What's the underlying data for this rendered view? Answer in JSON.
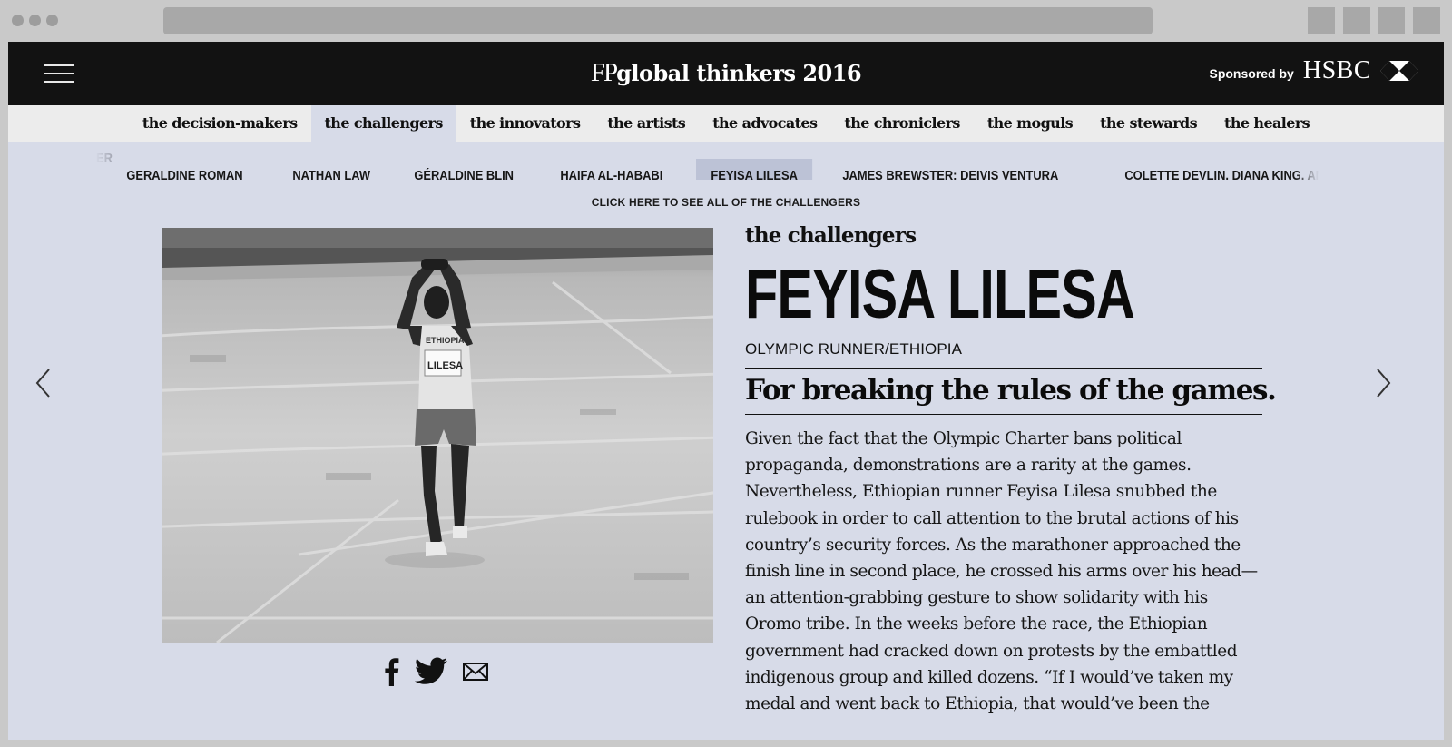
{
  "header": {
    "logo_fp": "FP",
    "logo_text": "global thinkers 2016",
    "sponsor_label": "Sponsored by",
    "sponsor_brand": "HSBC"
  },
  "categories": [
    {
      "label": "the decision-makers",
      "active": false
    },
    {
      "label": "the challengers",
      "active": true
    },
    {
      "label": "the innovators",
      "active": false
    },
    {
      "label": "the artists",
      "active": false
    },
    {
      "label": "the advocates",
      "active": false
    },
    {
      "label": "the chroniclers",
      "active": false
    },
    {
      "label": "the moguls",
      "active": false
    },
    {
      "label": "the stewards",
      "active": false
    },
    {
      "label": "the healers",
      "active": false
    }
  ],
  "names": [
    {
      "label": "ER",
      "partial": true,
      "active": false
    },
    {
      "label": "GERALDINE ROMAN",
      "partial": false,
      "active": false
    },
    {
      "label": "NATHAN LAW",
      "partial": false,
      "active": false
    },
    {
      "label": "GÉRALDINE BLIN",
      "partial": false,
      "active": false
    },
    {
      "label": "HAIFA AL-HABABI",
      "partial": false,
      "active": false
    },
    {
      "label": "FEYISA LILESA",
      "partial": false,
      "active": true
    },
    {
      "label": "JAMES BREWSTER; DEIVIS VENTURA",
      "partial": false,
      "active": false
    },
    {
      "label": "COLETTE DEVLIN, DIANA KING, AND KITTY O'KANE",
      "partial": false,
      "active": false
    }
  ],
  "see_all": "CLICK HERE TO SEE ALL OF THE CHALLENGERS",
  "photo": {
    "bib_country": "ETHIOPIA",
    "bib_name": "LILESA"
  },
  "article": {
    "kicker": "the challengers",
    "title": "FEYISA LILESA",
    "subtitle": "OLYMPIC RUNNER/ETHIOPIA",
    "dek": "For breaking the rules of the games.",
    "body": "Given the fact that the Olympic Charter bans political propaganda, demonstrations are a rarity at the games. Nevertheless, Ethiopian runner Feyisa Lilesa snubbed the rulebook in order to call attention to the brutal actions of his country’s security forces. As the marathoner approached the finish line in second place, he crossed his arms over his head—an attention-grabbing gesture to show solidarity with his Oromo tribe. In the weeks before the race, the Ethiopian government had cracked down on protests by the embattled indigenous group and killed dozens. “If I would’ve taken my medal and went back to Ethiopia, that would’ve been the"
  },
  "share": {
    "icons": [
      "facebook-icon",
      "twitter-icon",
      "email-icon"
    ]
  },
  "colors": {
    "header_bg": "#121212",
    "tabs_bg": "#ececec",
    "page_bg": "#d7dbe8",
    "active_name_bg": "#bcc2d6"
  }
}
